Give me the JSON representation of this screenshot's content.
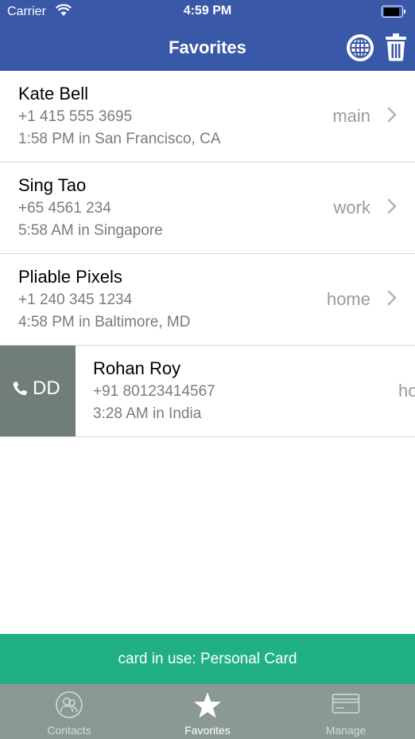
{
  "status_bar": {
    "carrier": "Carrier",
    "time": "4:59 PM",
    "battery_level_percent": 90
  },
  "nav": {
    "title": "Favorites",
    "icons": [
      "globe-icon",
      "trash-icon"
    ]
  },
  "contacts": [
    {
      "name": "Kate Bell",
      "phone": "+1 415 555 3695",
      "local_time": "1:58 PM in San Francisco, CA",
      "phone_type": "main"
    },
    {
      "name": "Sing Tao",
      "phone": "+65 4561 234",
      "local_time": "5:58 AM in Singapore",
      "phone_type": "work"
    },
    {
      "name": "Pliable Pixels",
      "phone": "+1 240 345 1234",
      "local_time": "4:58 PM in Baltimore, MD",
      "phone_type": "home"
    },
    {
      "name": "Rohan Roy",
      "phone": "+91 80123414567",
      "local_time": "3:28 AM in India",
      "phone_type": "ho",
      "swipe_action_label": "DD"
    }
  ],
  "card_banner": {
    "text": "card in use: Personal Card"
  },
  "tabbar": {
    "tabs": [
      {
        "label": "Contacts",
        "icon": "contacts-icon",
        "active": false
      },
      {
        "label": "Favorites",
        "icon": "star-icon",
        "active": true
      },
      {
        "label": "Manage",
        "icon": "card-icon",
        "active": false
      }
    ]
  },
  "colors": {
    "nav": "#3a58a8",
    "banner": "#21b085",
    "tabbar": "#8a9995",
    "swipe_action": "#717d7b"
  }
}
